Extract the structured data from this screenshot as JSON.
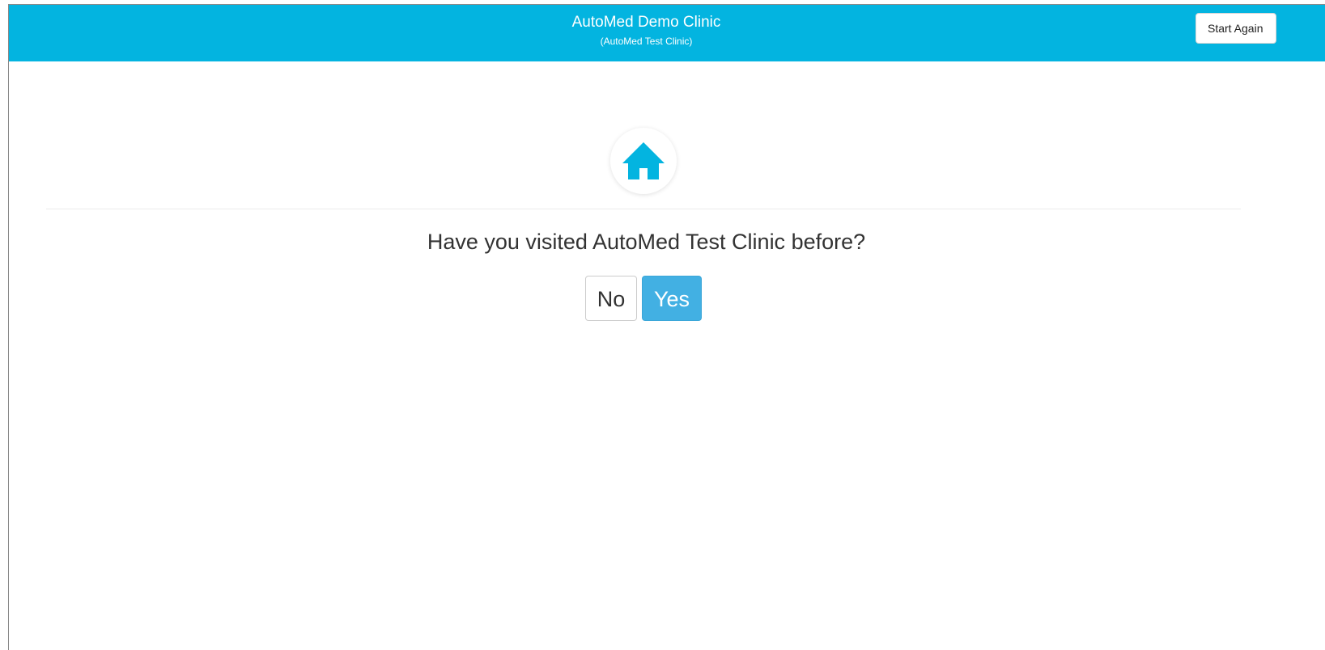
{
  "header": {
    "title": "AutoMed Demo Clinic",
    "subtitle": "(AutoMed Test Clinic)",
    "start_again_label": "Start Again",
    "background_color": "#03b4e0"
  },
  "main": {
    "icon": "home-icon",
    "question": "Have you visited AutoMed Test Clinic before?",
    "options": {
      "no_label": "No",
      "yes_label": "Yes"
    },
    "accent_color": "#42b0e3"
  }
}
